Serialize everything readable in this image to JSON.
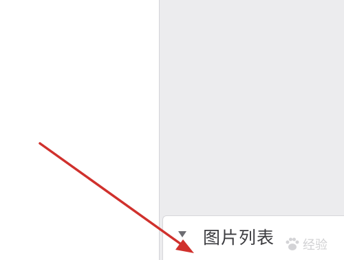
{
  "panel": {
    "title": "图片列表",
    "collapse_icon": "triangle-down-icon"
  },
  "watermark": {
    "text": "经验",
    "icon": "paw-icon"
  },
  "annotation": {
    "icon": "red-arrow-icon",
    "color": "#d0312d"
  },
  "colors": {
    "panel_background": "#ececee",
    "header_background": "#ffffff"
  }
}
